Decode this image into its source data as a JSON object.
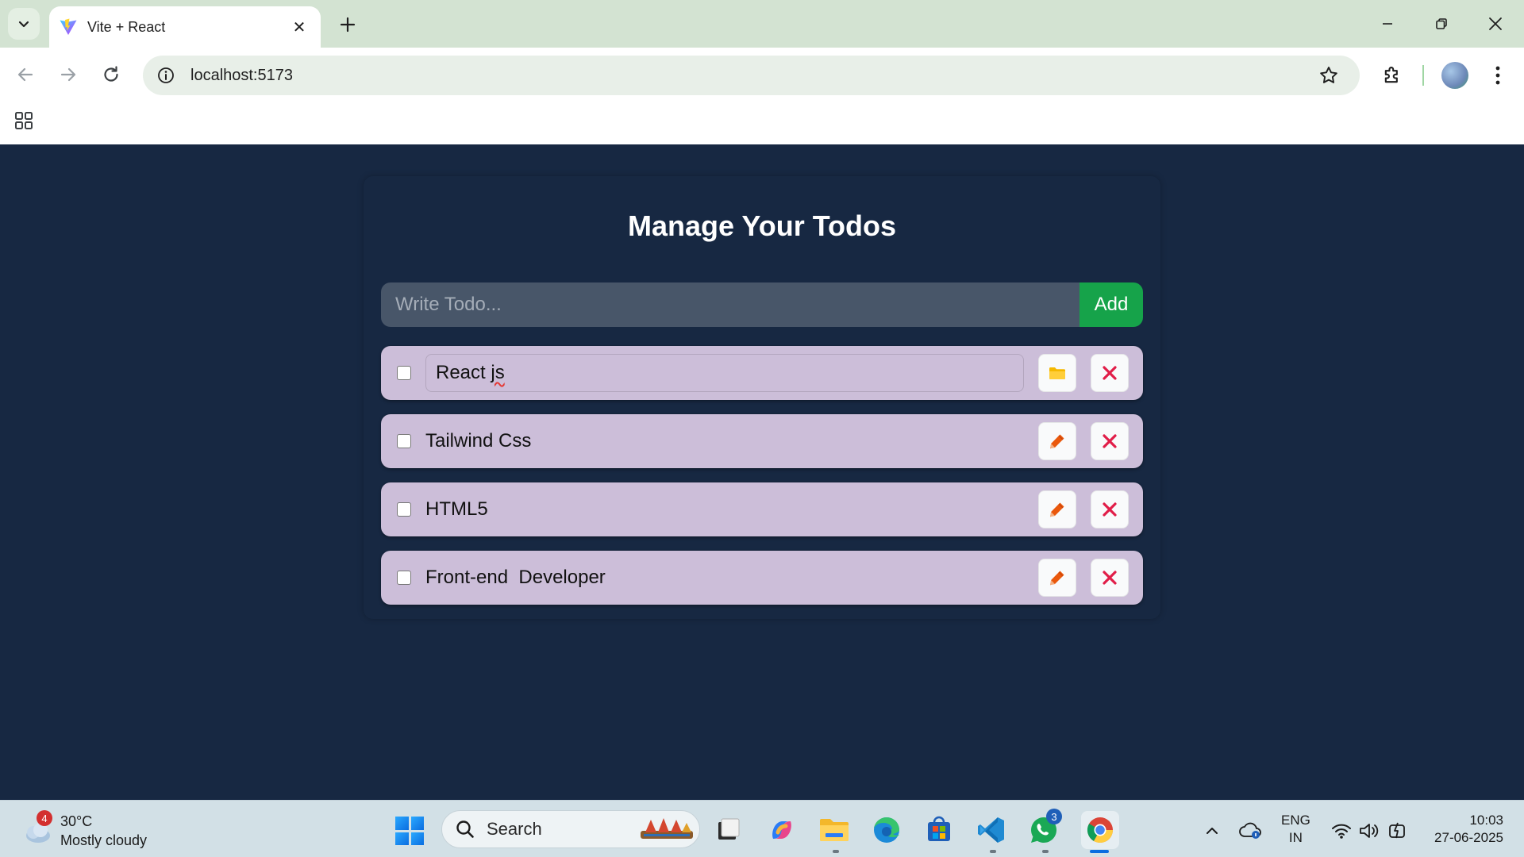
{
  "browser": {
    "tab_title": "Vite + React",
    "url": "localhost:5173"
  },
  "app": {
    "title": "Manage Your Todos",
    "input_placeholder": "Write Todo...",
    "add_label": "Add",
    "todos": [
      {
        "text_before": "React ",
        "text_misspelled": "js",
        "editing": true,
        "completed": false
      },
      {
        "text": "Tailwind Css",
        "editing": false,
        "completed": false
      },
      {
        "text": "HTML5",
        "editing": false,
        "completed": false
      },
      {
        "text": "Front-end  Developer",
        "editing": false,
        "completed": false
      }
    ]
  },
  "taskbar": {
    "weather_badge": "4",
    "temperature": "30°C",
    "condition": "Mostly cloudy",
    "search_label": "Search",
    "whatsapp_badge": "3",
    "lang_line1": "ENG",
    "lang_line2": "IN",
    "time": "10:03",
    "date": "27-06-2025"
  },
  "colors": {
    "page_bg": "#172842",
    "todo_bg": "#ccbed9",
    "add_green": "#16a34a",
    "delete_red": "#e11d48",
    "edit_orange": "#ea580c",
    "save_yellow": "#f5b800"
  }
}
